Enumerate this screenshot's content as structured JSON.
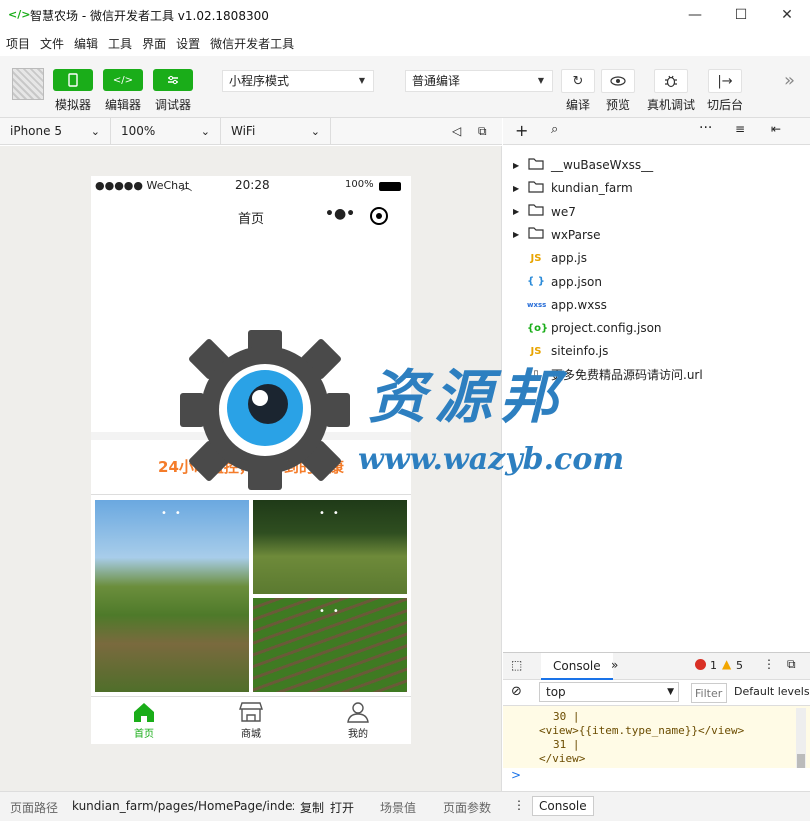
{
  "window": {
    "title": "智慧农场 - 微信开发者工具 v1.02.1808300",
    "controls": {
      "minimize": "—",
      "maximize": "☐",
      "close": "✕"
    }
  },
  "menu": [
    "项目",
    "文件",
    "编辑",
    "工具",
    "界面",
    "设置",
    "微信开发者工具"
  ],
  "toolbar": {
    "simulator": "模拟器",
    "editor": "编辑器",
    "debugger": "调试器",
    "mode_select": "小程序模式",
    "compile_select": "普通编译",
    "compile": "编译",
    "preview": "预览",
    "remote_debug": "真机调试",
    "background": "切后台",
    "more": "»"
  },
  "simbar": {
    "device": "iPhone 5",
    "zoom": "100%",
    "network": "WiFi"
  },
  "phone": {
    "carrier": "●●●●● WeChat",
    "time": "20:28",
    "battery": "100%",
    "nav_title": "首页",
    "slogan": "24小时监控，看得到的健康",
    "tabs": [
      "首页",
      "商城",
      "我的"
    ],
    "active_color": "#1aad19",
    "slogan_color": "#f47c2a"
  },
  "file_tree": [
    {
      "type": "folder",
      "name": "__wuBaseWxss__"
    },
    {
      "type": "folder",
      "name": "kundian_farm"
    },
    {
      "type": "folder",
      "name": "we7"
    },
    {
      "type": "folder",
      "name": "wxParse"
    },
    {
      "type": "js",
      "icon": "JS",
      "name": "app.js"
    },
    {
      "type": "json",
      "icon": "{ }",
      "name": "app.json"
    },
    {
      "type": "wxss",
      "icon": "wxss",
      "name": "app.wxss"
    },
    {
      "type": "config",
      "icon": "{o}",
      "name": "project.config.json"
    },
    {
      "type": "js",
      "icon": "JS",
      "name": "siteinfo.js"
    },
    {
      "type": "url",
      "icon": "▯",
      "name": "更多免费精品源码请访问.url"
    }
  ],
  "console": {
    "tab": "Console",
    "errors": "1",
    "warnings": "5",
    "context": "top",
    "filter_placeholder": "Filter",
    "levels": "Default levels",
    "lines": [
      "30 |",
      "<view>{{item.type_name}}</view>",
      "31 |",
      "</view>"
    ],
    "prompt": ">",
    "drawer_tab": "Console"
  },
  "bottombar": {
    "path_label": "页面路径",
    "path_value": "kundian_farm/pages/HomePage/index/i...",
    "copy": "复制",
    "open": "打开",
    "scene": "场景值",
    "params": "页面参数"
  },
  "watermark": {
    "text": "资源邦",
    "url": "www.wazyb.com"
  }
}
